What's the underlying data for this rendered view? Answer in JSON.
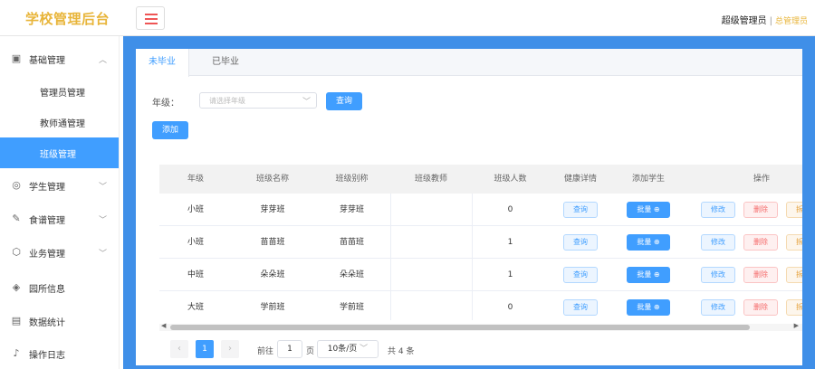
{
  "header": {
    "logo": "学校管理后台",
    "role": "超级管理员",
    "separator": "|",
    "username": "总管理员"
  },
  "sidebar": {
    "items": [
      {
        "label": "基础管理",
        "icon": "calendar-icon",
        "expanded": true
      },
      {
        "label": "管理员管理",
        "sub": true
      },
      {
        "label": "教师通管理",
        "sub": true
      },
      {
        "label": "班级管理",
        "sub": true,
        "active": true
      },
      {
        "label": "学生管理",
        "icon": "compass-icon"
      },
      {
        "label": "食谱管理",
        "icon": "edit-icon"
      },
      {
        "label": "业务管理",
        "icon": "cube-icon"
      },
      {
        "label": "园所信息",
        "icon": "box-icon"
      },
      {
        "label": "数据统计",
        "icon": "chart-icon"
      },
      {
        "label": "操作日志",
        "icon": "bell-icon"
      }
    ]
  },
  "tabs": [
    {
      "label": "未毕业",
      "active": true
    },
    {
      "label": "已毕业"
    }
  ],
  "filter": {
    "grade_label": "年级：",
    "grade_placeholder": "请选择年级",
    "query_button": "查询",
    "add_button": "添加"
  },
  "table": {
    "headers": [
      "年级",
      "班级名称",
      "班级别称",
      "班级教师",
      "班级人数",
      "健康详情",
      "添加学生",
      "操作"
    ],
    "rows": [
      {
        "grade": "小班",
        "name": "芽芽班",
        "alias": "芽芽班",
        "teacher": "",
        "count": "0"
      },
      {
        "grade": "小班",
        "name": "苗苗班",
        "alias": "苗苗班",
        "teacher": "",
        "count": "1"
      },
      {
        "grade": "中班",
        "name": "朵朵班",
        "alias": "朵朵班",
        "teacher": "",
        "count": "1"
      },
      {
        "grade": "大班",
        "name": "学前班",
        "alias": "学前班",
        "teacher": "",
        "count": "0"
      }
    ],
    "health_button": "查询",
    "batch_button": "批量",
    "edit_button": "修改",
    "delete_button": "删除",
    "split_button": "拆班"
  },
  "pagination": {
    "current_page": "1",
    "goto_label": "前往",
    "goto_value": "1",
    "page_unit": "页",
    "page_size": "10条/页",
    "total": "共 4 条"
  },
  "colors": {
    "primary": "#409eff",
    "main_bg": "#3f8fe8",
    "logo": "#e8b53a"
  }
}
